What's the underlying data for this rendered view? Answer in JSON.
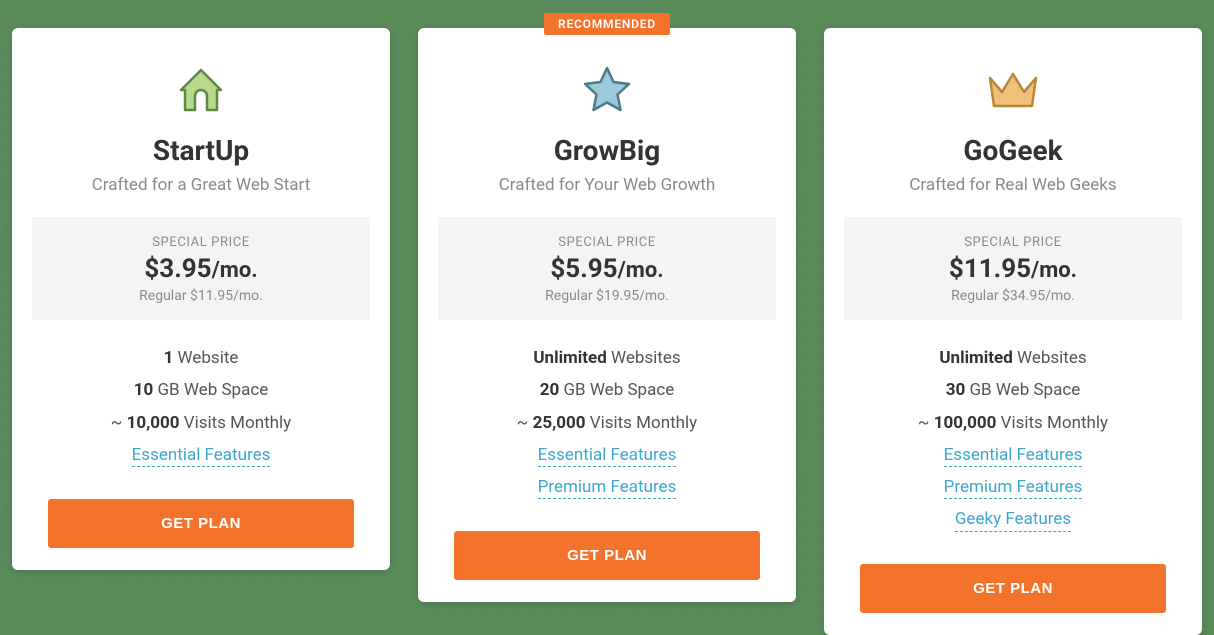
{
  "recommended_label": "RECOMMENDED",
  "plans": [
    {
      "name": "StartUp",
      "tagline": "Crafted for a Great Web Start",
      "price_label": "SPECIAL PRICE",
      "price": "$3.95",
      "price_unit": "/mo.",
      "regular": "Regular $11.95/mo.",
      "feat1_bold": "1",
      "feat1_rest": " Website",
      "feat2_bold": "10",
      "feat2_rest": " GB Web Space",
      "feat3_pre": "~ ",
      "feat3_bold": "10,000",
      "feat3_rest": " Visits Monthly",
      "link1": "Essential Features",
      "button": "GET PLAN"
    },
    {
      "name": "GrowBig",
      "tagline": "Crafted for Your Web Growth",
      "price_label": "SPECIAL PRICE",
      "price": "$5.95",
      "price_unit": "/mo.",
      "regular": "Regular $19.95/mo.",
      "feat1_bold": "Unlimited",
      "feat1_rest": " Websites",
      "feat2_bold": "20",
      "feat2_rest": " GB Web Space",
      "feat3_pre": "~ ",
      "feat3_bold": "25,000",
      "feat3_rest": " Visits Monthly",
      "link1": "Essential Features",
      "link2": "Premium Features",
      "button": "GET PLAN"
    },
    {
      "name": "GoGeek",
      "tagline": "Crafted for Real Web Geeks",
      "price_label": "SPECIAL PRICE",
      "price": "$11.95",
      "price_unit": "/mo.",
      "regular": "Regular $34.95/mo.",
      "feat1_bold": "Unlimited",
      "feat1_rest": " Websites",
      "feat2_bold": "30",
      "feat2_rest": " GB Web Space",
      "feat3_pre": "~ ",
      "feat3_bold": "100,000",
      "feat3_rest": " Visits Monthly",
      "link1": "Essential Features",
      "link2": "Premium Features",
      "link3": "Geeky Features",
      "button": "GET PLAN"
    }
  ]
}
